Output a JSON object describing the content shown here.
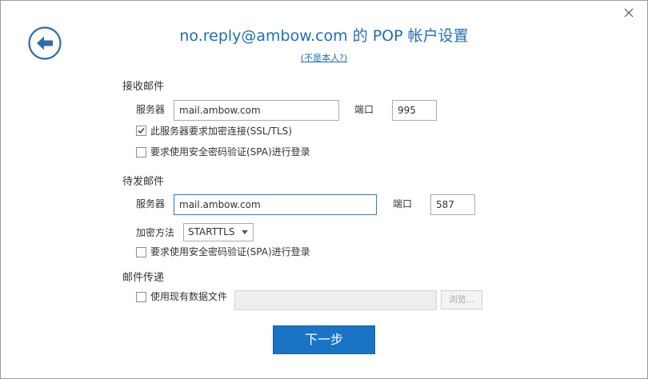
{
  "header": {
    "title": "no.reply@ambow.com 的 POP 帐户设置",
    "not_me_link": "(不是本人?)"
  },
  "incoming": {
    "heading": "接收邮件",
    "server_label": "服务器",
    "server_value": "mail.ambow.com",
    "port_label": "端口",
    "port_value": "995",
    "ssl_label": "此服务器要求加密连接(SSL/TLS)",
    "ssl_checked": true,
    "spa_label": "要求使用安全密码验证(SPA)进行登录",
    "spa_checked": false
  },
  "outgoing": {
    "heading": "待发邮件",
    "server_label": "服务器",
    "server_value": "mail.ambow.com",
    "port_label": "端口",
    "port_value": "587",
    "encryption_label": "加密方法",
    "encryption_value": "STARTTLS",
    "spa_label": "要求使用安全密码验证(SPA)进行登录",
    "spa_checked": false
  },
  "delivery": {
    "heading": "邮件传递",
    "use_existing_label": "使用现有数据文件",
    "use_existing_checked": false,
    "file_path_value": "",
    "browse_label": "浏览..."
  },
  "footer": {
    "next_label": "下一步"
  },
  "colors": {
    "accent": "#1f6fb5",
    "primary_button": "#1a73c4",
    "focus_border": "#2b7ac8"
  }
}
